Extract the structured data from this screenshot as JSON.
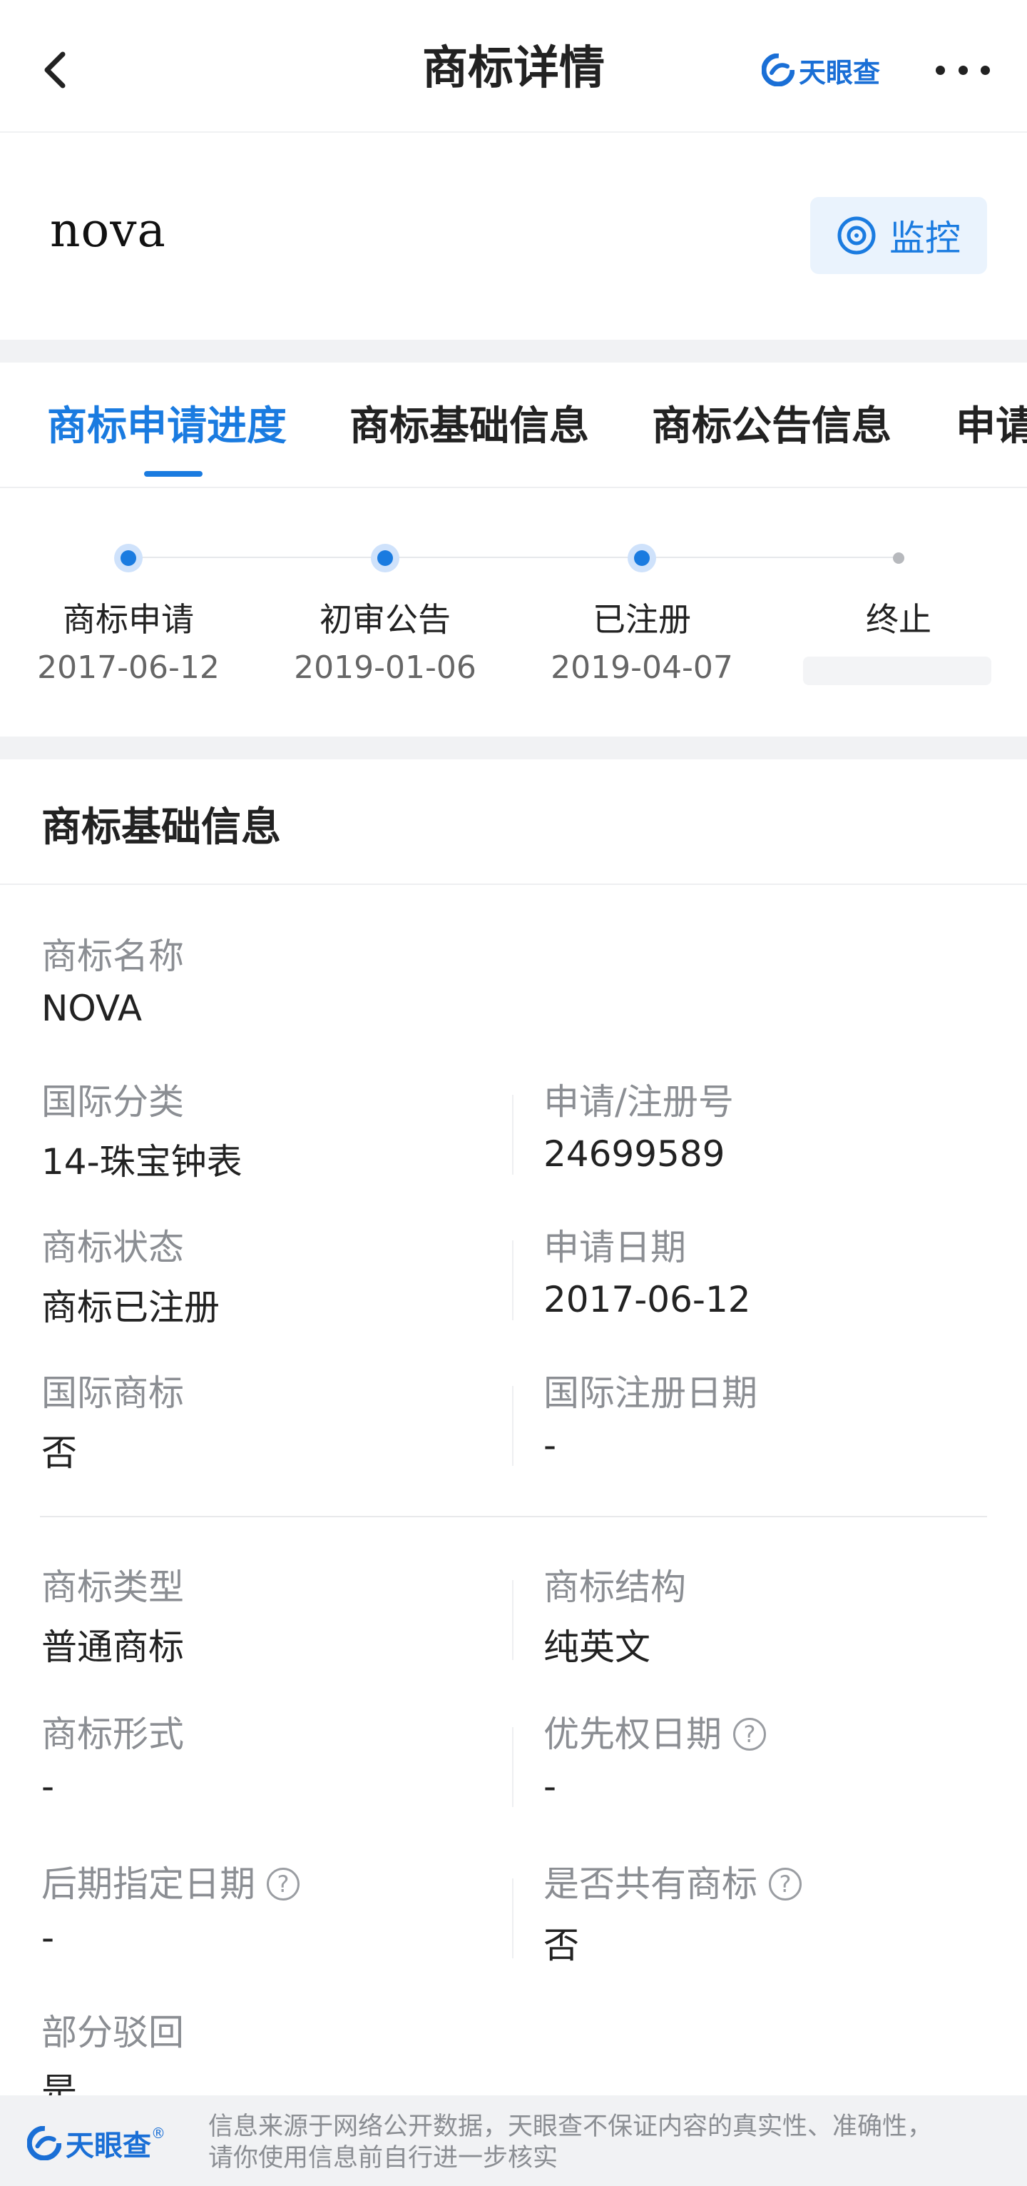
{
  "header": {
    "title": "商标详情",
    "brand": "天眼查",
    "back_icon": "chevron-left-icon",
    "more_icon": "more-horizontal-icon"
  },
  "trademark": {
    "name": "nova",
    "monitor_label": "监控",
    "monitor_icon": "target-icon"
  },
  "tabs": [
    {
      "label": "商标申请进度",
      "active": true
    },
    {
      "label": "商标基础信息",
      "active": false
    },
    {
      "label": "商标公告信息",
      "active": false
    },
    {
      "label": "申请",
      "active": false
    }
  ],
  "progress": {
    "steps": [
      {
        "label": "商标申请",
        "date": "2017-06-12",
        "status": "done"
      },
      {
        "label": "初审公告",
        "date": "2019-01-06",
        "status": "done"
      },
      {
        "label": "已注册",
        "date": "2019-04-07",
        "status": "done"
      },
      {
        "label": "终止",
        "date": "",
        "status": "pending"
      }
    ]
  },
  "basic_info": {
    "title": "商标基础信息",
    "trademark_name_label": "商标名称",
    "trademark_name": "NOVA",
    "intl_class_label": "国际分类",
    "intl_class": "14-珠宝钟表",
    "reg_no_label": "申请/注册号",
    "reg_no": "24699589",
    "status_label": "商标状态",
    "status": "商标已注册",
    "apply_date_label": "申请日期",
    "apply_date": "2017-06-12",
    "intl_tm_label": "国际商标",
    "intl_tm": "否",
    "intl_reg_date_label": "国际注册日期",
    "intl_reg_date": "-",
    "type_label": "商标类型",
    "type": "普通商标",
    "structure_label": "商标结构",
    "structure": "纯英文",
    "form_label": "商标形式",
    "form": "-",
    "priority_date_label": "优先权日期",
    "priority_date": "-",
    "later_date_label": "后期指定日期",
    "later_date": "-",
    "shared_label": "是否共有商标",
    "shared": "否",
    "partial_reject_label": "部分驳回",
    "partial_reject": "是",
    "help_icon_text": "?"
  },
  "footer": {
    "brand": "天眼查",
    "registered_mark": "®",
    "disclaimer_line1": "信息来源于网络公开数据，天眼查不保证内容的真实性、准确性，",
    "disclaimer_line2": "请你使用信息前自行进一步核实"
  },
  "colors": {
    "accent": "#1a7be0",
    "muted": "#8b8e93",
    "background_gap": "#f1f2f4"
  }
}
